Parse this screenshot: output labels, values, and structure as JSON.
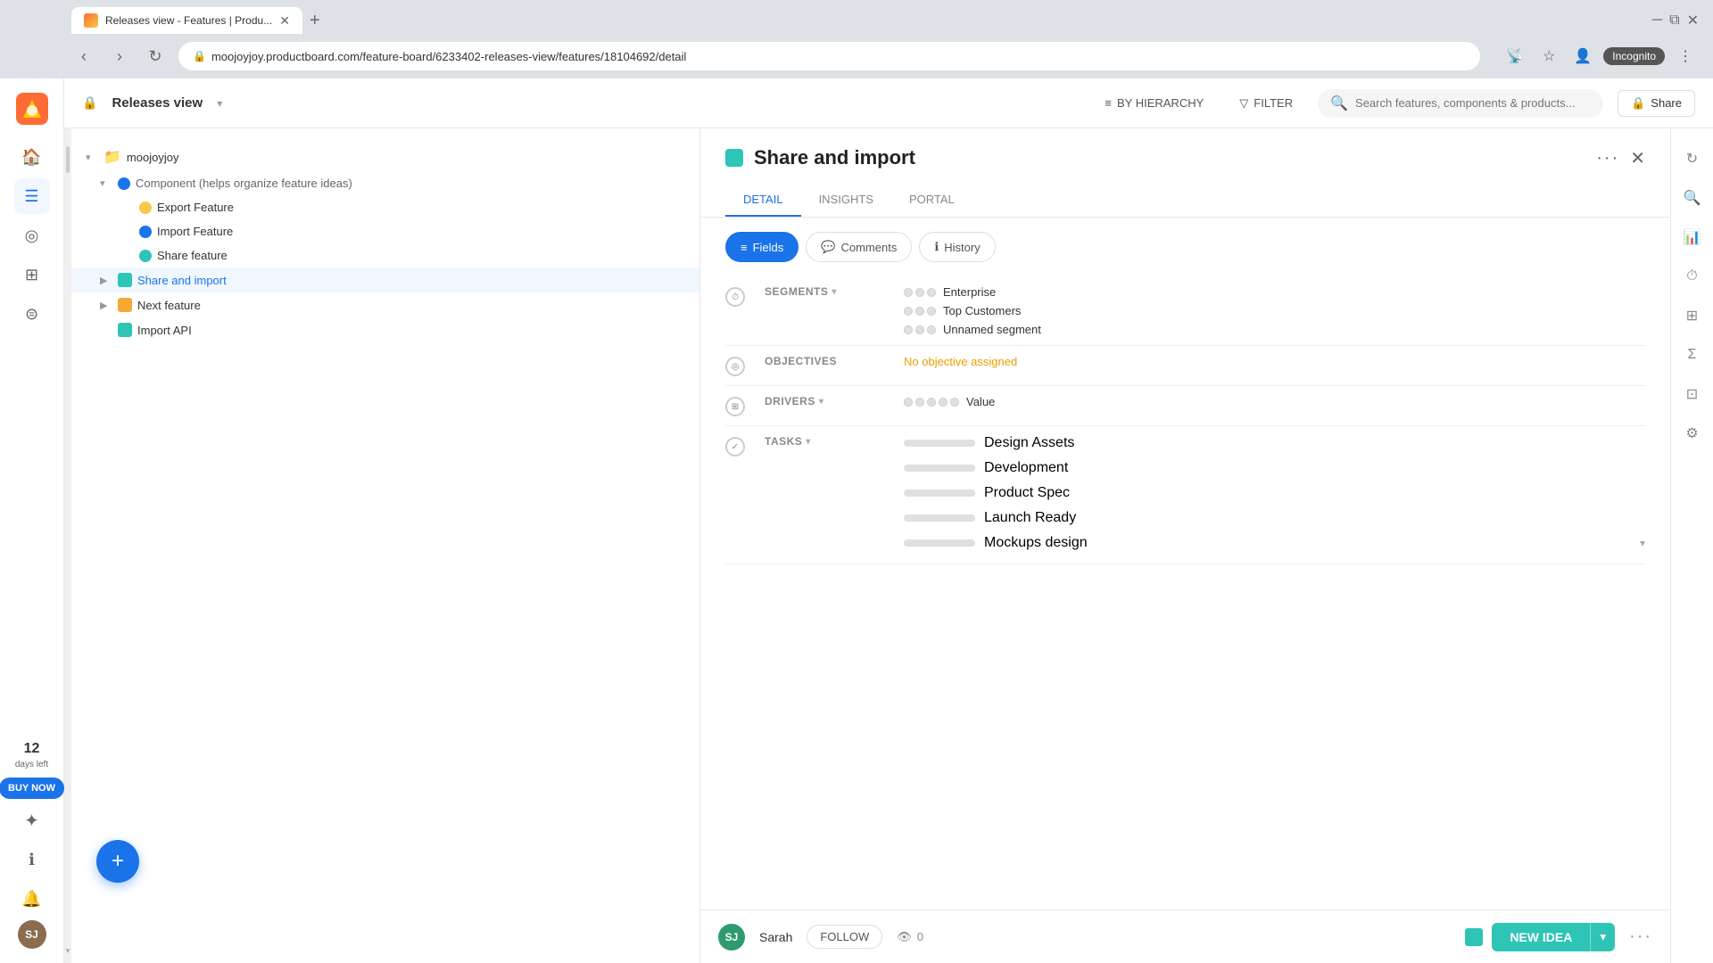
{
  "browser": {
    "tab_title": "Releases view - Features | Produ...",
    "url": "moojoyjoy.productboard.com/feature-board/6233402-releases-view/features/18104692/detail",
    "url_full": "moojoyjoy.productboard.com/feature-board/6233402-releases-view/features/18104692/detail",
    "incognito_label": "Incognito"
  },
  "topbar": {
    "lock_icon": "🔒",
    "view_title": "Releases view",
    "by_hierarchy_label": "BY HIERARCHY",
    "filter_label": "FILTER",
    "search_placeholder": "Search features, components & products...",
    "share_label": "Share"
  },
  "feature_tree": {
    "root_label": "moojoyjoy",
    "component_label": "Component (helps organize feature ideas)",
    "items": [
      {
        "label": "Export Feature",
        "color": "#f7c948",
        "indent": 2
      },
      {
        "label": "Import Feature",
        "color": "#1a73e8",
        "indent": 2
      },
      {
        "label": "Share feature",
        "color": "#2ec4b6",
        "indent": 2
      }
    ],
    "selected_label": "Share and import",
    "next_feature_label": "Next feature",
    "import_api_label": "Import API"
  },
  "detail": {
    "title": "Share and import",
    "color": "#2ec4b6",
    "tabs": [
      {
        "label": "DETAIL",
        "active": true
      },
      {
        "label": "INSIGHTS",
        "active": false
      },
      {
        "label": "PORTAL",
        "active": false
      }
    ],
    "sub_tabs": [
      {
        "label": "Fields",
        "icon": "≡",
        "active": true
      },
      {
        "label": "Comments",
        "icon": "💬",
        "active": false
      },
      {
        "label": "History",
        "icon": "ℹ",
        "active": false
      }
    ],
    "fields": {
      "segments": {
        "label": "SEGMENTS",
        "values": [
          "Enterprise",
          "Top Customers",
          "Unnamed segment"
        ]
      },
      "objectives": {
        "label": "OBJECTIVES",
        "value": "No objective assigned"
      },
      "drivers": {
        "label": "DRIVERS",
        "value": "Value"
      },
      "tasks": {
        "label": "TASKS",
        "items": [
          "Design Assets",
          "Development",
          "Product Spec",
          "Launch Ready",
          "Mockups design"
        ]
      }
    }
  },
  "bottom_bar": {
    "user_avatar_initials": "SJ",
    "user_name": "Sarah",
    "follow_label": "FOLLOW",
    "watch_count": "0",
    "new_idea_label": "NEW IDEA"
  },
  "sidebar": {
    "days_left_count": "12",
    "days_left_label": "days left",
    "buy_now_label": "BUY NOW"
  },
  "fab_icon": "+"
}
